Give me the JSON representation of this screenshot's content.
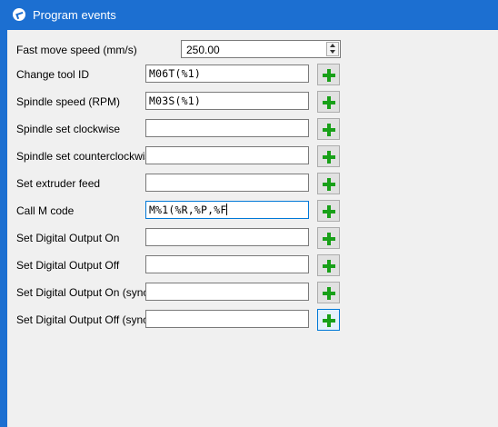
{
  "window": {
    "title": "Program events",
    "icon": "app-icon"
  },
  "fast_move": {
    "label": "Fast move speed (mm/s)",
    "value": "250.00"
  },
  "rows": [
    {
      "label": "Change tool ID",
      "value": "M06T(%1)"
    },
    {
      "label": "Spindle speed (RPM)",
      "value": "M03S(%1)"
    },
    {
      "label": "Spindle set clockwise",
      "value": ""
    },
    {
      "label": "Spindle set counterclockwise",
      "value": ""
    },
    {
      "label": "Set extruder feed",
      "value": ""
    },
    {
      "label": "Call M code",
      "value": "M%1(%R,%P,%F"
    },
    {
      "label": "Set Digital Output On",
      "value": ""
    },
    {
      "label": "Set Digital Output Off",
      "value": ""
    },
    {
      "label": "Set Digital Output On (sync)",
      "value": ""
    },
    {
      "label": "Set Digital Output Off (sync)",
      "value": ""
    }
  ],
  "add_button_icon": "green-plus-icon",
  "colors": {
    "titlebar": "#1c6fd1",
    "plus": "#18a018",
    "panel": "#f0f0f0"
  }
}
